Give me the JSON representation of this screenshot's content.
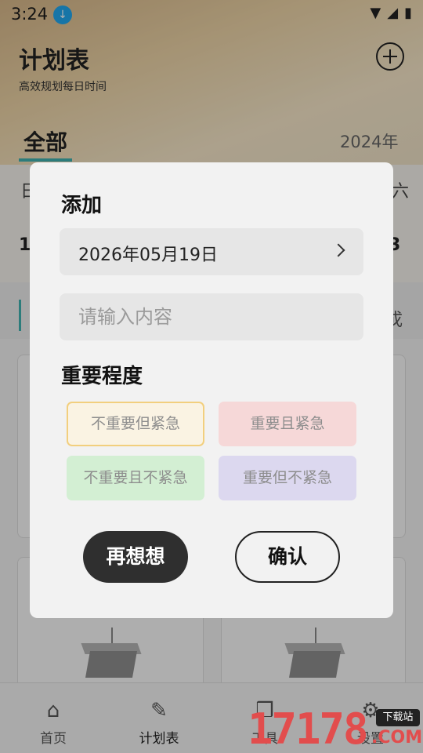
{
  "status_bar": {
    "time": "3:24",
    "download_icon": "download-arrow-icon",
    "wifi_icon": "▼",
    "signal_icon": "◢",
    "battery_icon": "▮"
  },
  "header": {
    "title": "计划表",
    "subtitle": "高效规划每日时间",
    "add_icon": "plus-circle-icon"
  },
  "tabs": {
    "active": "全部",
    "year": "2024年"
  },
  "week": {
    "first_day": "日",
    "last_day": "六",
    "first_date": "1",
    "last_date": "3"
  },
  "filter": {
    "right_label": "戓"
  },
  "dialog": {
    "title": "添加",
    "date_value": "2026年05月19日",
    "content_placeholder": "请输入内容",
    "content_value": "",
    "priority_title": "重要程度",
    "priorities": [
      {
        "label": "不重要但紧急",
        "color": "#faf3e3",
        "selected": true
      },
      {
        "label": "重要且紧急",
        "color": "#f6d8d8",
        "selected": false
      },
      {
        "label": "不重要且不紧急",
        "color": "#d3efd3",
        "selected": false
      },
      {
        "label": "重要但不紧急",
        "color": "#dcd8ef",
        "selected": false
      }
    ],
    "cancel_label": "再想想",
    "confirm_label": "确认"
  },
  "tabbar": {
    "items": [
      {
        "label": "首页",
        "icon": "home-icon"
      },
      {
        "label": "计划表",
        "icon": "edit-icon"
      },
      {
        "label": "工具",
        "icon": "gift-icon"
      },
      {
        "label": "设置",
        "icon": "settings-icon"
      }
    ]
  },
  "watermark": {
    "number": "17178",
    "badge": "下载站",
    "domain": ".COM"
  },
  "colors": {
    "accent": "#3fb2b0",
    "dark_button": "#2f2f2f"
  }
}
